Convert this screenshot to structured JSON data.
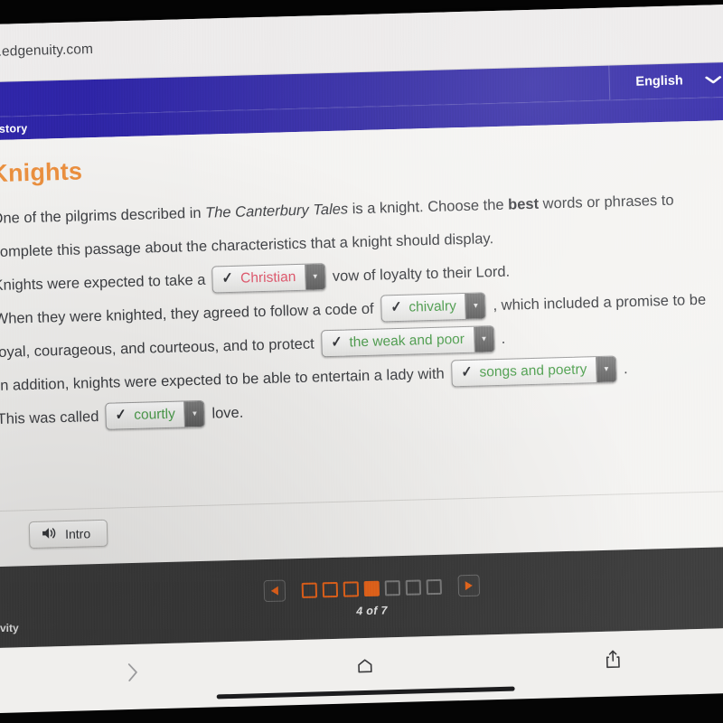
{
  "browser": {
    "url": "rn.edgenuity.com",
    "bottom_bar": {
      "forward_icon": "chevron-right-icon",
      "home_icon": "home-icon",
      "share_icon": "share-icon"
    }
  },
  "appbar": {
    "language": "English",
    "language_chevron": "chevron-down-icon",
    "subject": "History"
  },
  "lesson": {
    "title": "Knights",
    "instruction": {
      "part1": "One of the pilgrims described in ",
      "italic": "The Canterbury Tales",
      "part2": " is a knight. Choose the ",
      "bold": "best",
      "part3": " words or phrases to complete this passage about the characteristics that a knight should display."
    },
    "sentences": [
      {
        "before": "Knights were expected to take a",
        "answer": "Christian",
        "state": "incorrect",
        "after": "vow of loyalty to their Lord."
      },
      {
        "before": "When they were knighted, they agreed to follow a code of",
        "answer": "chivalry",
        "state": "correct",
        "after": ", which included a promise to be loyal, courageous, and courteous, and to protect"
      },
      {
        "before": "",
        "answer": "the weak and poor",
        "state": "correct",
        "after": "."
      },
      {
        "before": "In addition, knights were expected to be able to entertain a lady with",
        "answer": "songs and poetry",
        "state": "correct",
        "after": "."
      },
      {
        "before": "This was called",
        "answer": "courtly",
        "state": "correct",
        "after": "love."
      }
    ],
    "check_icon": "check-icon",
    "dropdown_icon": "caret-down-icon",
    "audio_button": {
      "label": "Intro",
      "icon": "speaker-icon"
    }
  },
  "pager": {
    "prev_icon": "triangle-left-icon",
    "next_icon": "triangle-right-icon",
    "label": "4 of 7",
    "total": 7,
    "current": 4,
    "dots": [
      "visited",
      "visited",
      "visited",
      "current",
      "upcoming",
      "upcoming",
      "upcoming"
    ]
  },
  "overlay": {
    "cropped_activity_text": "vity"
  },
  "colors": {
    "appbar_indigo": "#2c23a2",
    "title_orange": "#ec8b3c",
    "correct_green": "#4b9d4b",
    "incorrect_red": "#e2556b",
    "pager_orange": "#e8661c",
    "pager_bg": "#3b3b3b"
  }
}
